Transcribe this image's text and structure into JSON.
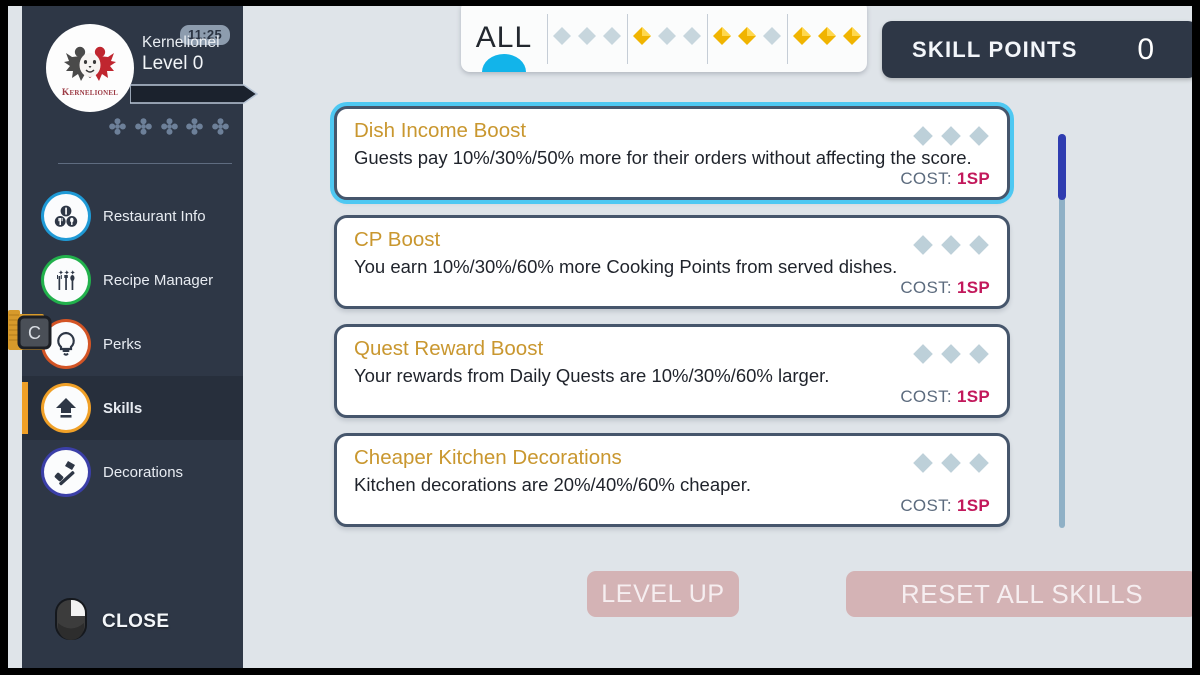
{
  "sidebar": {
    "clock": "11:25",
    "avatar": {
      "name": "avatar",
      "logo_text": "Kernelionel"
    },
    "player_name": "Kernelionel",
    "player_level": "Level 0",
    "menu_items": [
      {
        "label": "Restaurant Info",
        "icon": "restaurant-info-icon",
        "ring_color": "#1f9ad6",
        "active": false
      },
      {
        "label": "Recipe Manager",
        "icon": "recipe-manager-icon",
        "ring_color": "#22b14c",
        "active": false
      },
      {
        "label": "Perks",
        "icon": "perks-bulb-icon",
        "ring_color": "#d35425",
        "active": false
      },
      {
        "label": "Skills",
        "icon": "skills-upgrade-icon",
        "ring_color": "#f0a027",
        "active": true
      },
      {
        "label": "Decorations",
        "icon": "decorations-hammer-icon",
        "ring_color": "#3b3fa8",
        "active": false
      }
    ],
    "key_hint": "C",
    "close_label": "CLOSE",
    "close_icon": "mouse-right-click-icon"
  },
  "tabs": [
    {
      "label": "ALL",
      "type": "text",
      "filled": 0,
      "active": true
    },
    {
      "label": "",
      "type": "diamonds",
      "filled": 0,
      "active": false
    },
    {
      "label": "",
      "type": "diamonds",
      "filled": 1,
      "active": false
    },
    {
      "label": "",
      "type": "diamonds",
      "filled": 2,
      "active": false
    },
    {
      "label": "",
      "type": "diamonds",
      "filled": 3,
      "active": false
    }
  ],
  "skill_points": {
    "label": "SKILL POINTS",
    "value": "0"
  },
  "skills": [
    {
      "title": "Dish Income Boost",
      "description": "Guests pay 10%/30%/50% more for their orders without affecting the score.",
      "cost_label": "COST:",
      "cost_value": "1SP",
      "tiers": 3,
      "tiers_filled": 0,
      "selected": true
    },
    {
      "title": "CP Boost",
      "description": "You earn 10%/30%/60% more Cooking Points from served dishes.",
      "cost_label": "COST:",
      "cost_value": "1SP",
      "tiers": 3,
      "tiers_filled": 0,
      "selected": false
    },
    {
      "title": "Quest Reward Boost",
      "description": "Your rewards from Daily Quests are 10%/30%/60% larger.",
      "cost_label": "COST:",
      "cost_value": "1SP",
      "tiers": 3,
      "tiers_filled": 0,
      "selected": false
    },
    {
      "title": "Cheaper Kitchen Decorations",
      "description": "Kitchen decorations are 20%/40%/60% cheaper.",
      "cost_label": "COST:",
      "cost_value": "1SP",
      "tiers": 3,
      "tiers_filled": 0,
      "selected": false
    }
  ],
  "buttons": {
    "level_up": "LEVEL UP",
    "reset_all_skills": "RESET ALL SKILLS"
  },
  "colors": {
    "sidebar_bg": "#2e3746",
    "content_bg": "#dfe4e9",
    "accent_orange": "#f0a027",
    "accent_cyan": "#12b4ea",
    "card_title": "#c9972f",
    "cost_pink": "#c2185b",
    "diamond_filled": "#f0b400",
    "diamond_empty": "#c7d6dd",
    "button_disabled": "#d4b3b5",
    "scroll_thumb": "#2f3cb0"
  }
}
